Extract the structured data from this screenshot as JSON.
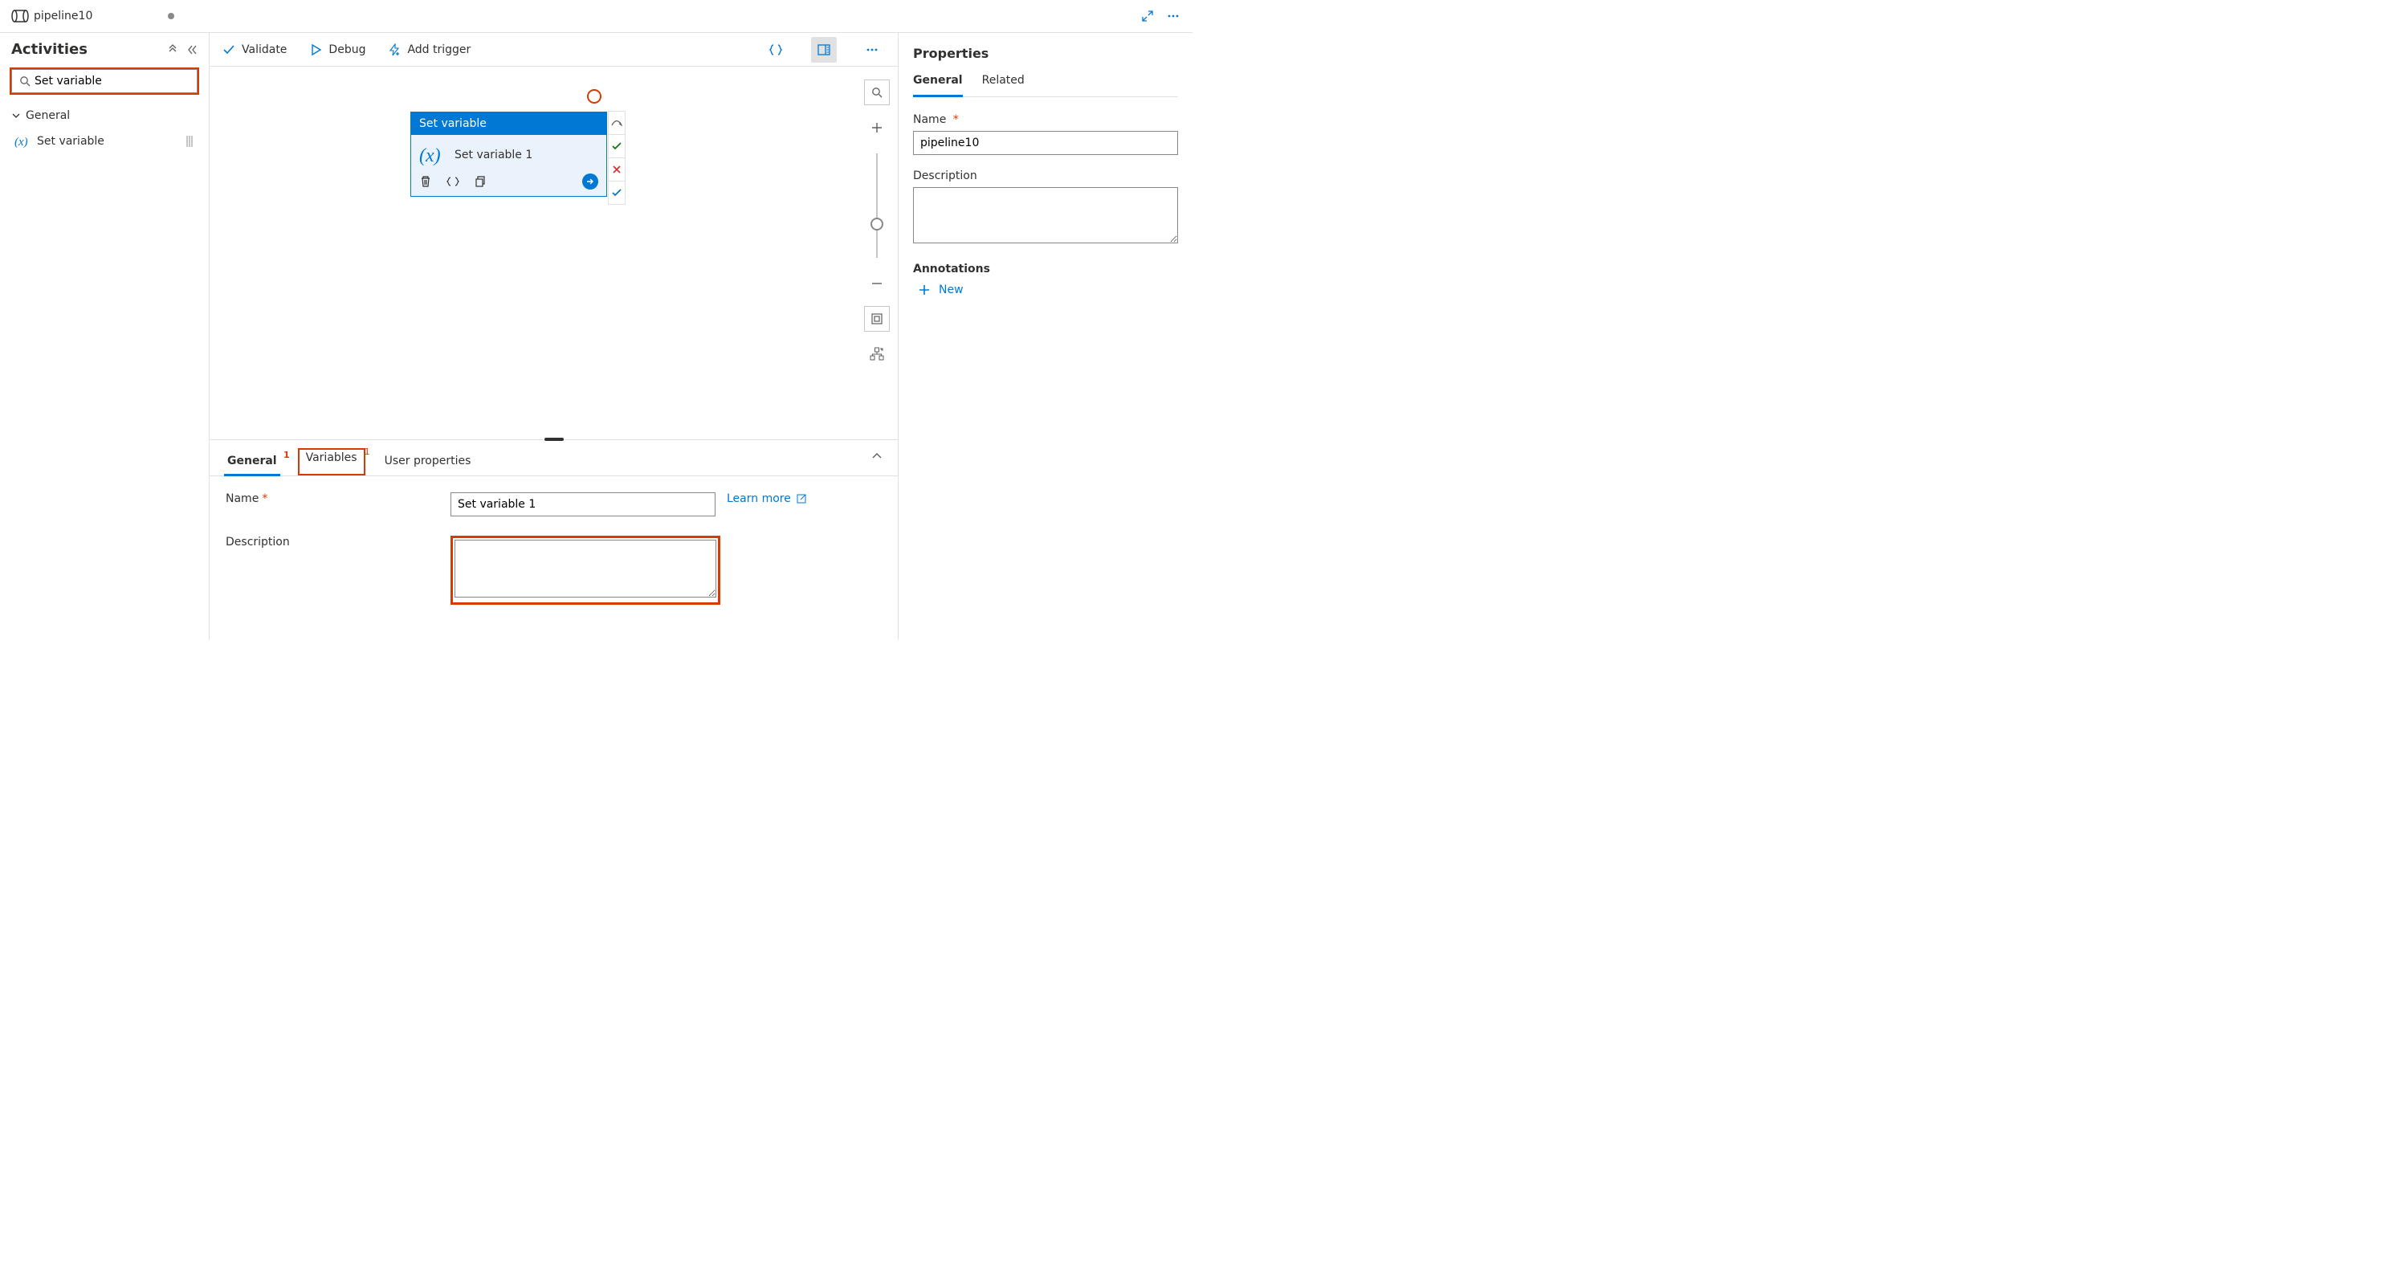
{
  "tab": {
    "name": "pipeline10"
  },
  "sidebar": {
    "title": "Activities",
    "search_value": "Set variable",
    "group": "General",
    "items": [
      {
        "label": "Set variable"
      }
    ]
  },
  "toolbar": {
    "validate": "Validate",
    "debug": "Debug",
    "add_trigger": "Add trigger"
  },
  "canvas": {
    "activity": {
      "type": "Set variable",
      "name": "Set variable 1"
    }
  },
  "bottom": {
    "tabs": {
      "general": "General",
      "variables": "Variables",
      "user_properties": "User properties",
      "badge_general": "1",
      "badge_variables": "1"
    },
    "labels": {
      "name": "Name",
      "description": "Description",
      "learn_more": "Learn more"
    },
    "values": {
      "name": "Set variable 1",
      "description": ""
    }
  },
  "props": {
    "title": "Properties",
    "tabs": {
      "general": "General",
      "related": "Related"
    },
    "labels": {
      "name": "Name",
      "description": "Description",
      "annotations": "Annotations",
      "new": "New"
    },
    "values": {
      "name": "pipeline10",
      "description": ""
    }
  }
}
